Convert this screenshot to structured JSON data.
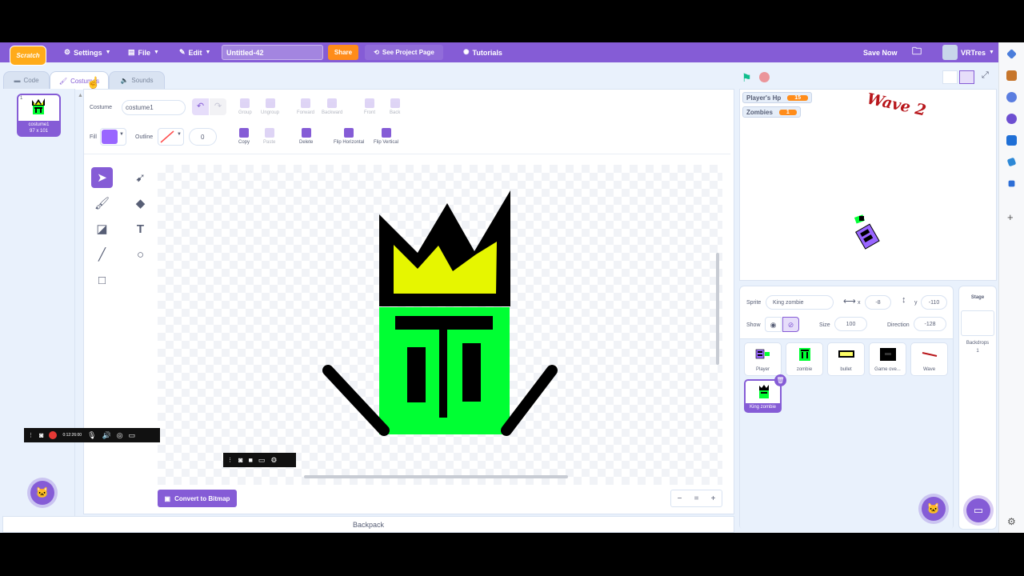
{
  "menu": {
    "logo": "Scratch",
    "settings": "Settings",
    "file": "File",
    "edit": "Edit",
    "project_title": "Untitled-42",
    "share": "Share",
    "see_project": "See Project Page",
    "tutorials": "Tutorials",
    "save_now": "Save Now",
    "username": "VRTres"
  },
  "tabs": {
    "code": "Code",
    "costumes": "Costumes",
    "sounds": "Sounds"
  },
  "costume_list": [
    {
      "index": "1",
      "name": "costume1",
      "size": "97 x 101"
    }
  ],
  "editor": {
    "costume_label": "Costume",
    "costume_name": "costume1",
    "group": "Group",
    "ungroup": "Ungroup",
    "forward": "Forward",
    "backward": "Backward",
    "front": "Front",
    "back": "Back",
    "fill_label": "Fill",
    "outline_label": "Outline",
    "outline_width": "0",
    "copy": "Copy",
    "paste": "Paste",
    "delete": "Delete",
    "flip_horizontal": "Flip Horizontal",
    "flip_vertical": "Flip Vertical",
    "convert": "Convert to Bitmap",
    "fill_color": "#9966ff",
    "zoom_out": "−",
    "zoom_reset": "=",
    "zoom_in": "+"
  },
  "backpack": "Backpack",
  "stage": {
    "monitors": [
      {
        "label": "Player's Hp",
        "value": "15"
      },
      {
        "label": "Zombies",
        "value": "1"
      }
    ],
    "wave_text": "Wave 2"
  },
  "sprite_info": {
    "sprite_label": "Sprite",
    "sprite_name": "King zombie",
    "x_label": "x",
    "x_value": "-8",
    "y_label": "y",
    "y_value": "-110",
    "show_label": "Show",
    "size_label": "Size",
    "size_value": "100",
    "direction_label": "Direction",
    "direction_value": "-128"
  },
  "sprites": [
    {
      "name": "Player"
    },
    {
      "name": "zombie"
    },
    {
      "name": "bullet"
    },
    {
      "name": "Game ove..."
    },
    {
      "name": "Wave"
    },
    {
      "name": "King zombie"
    }
  ],
  "stage_pane": {
    "title": "Stage",
    "backdrops_label": "Backdrops",
    "backdrops_count": "1"
  },
  "recorder": {
    "time": "0:12:26:00"
  }
}
